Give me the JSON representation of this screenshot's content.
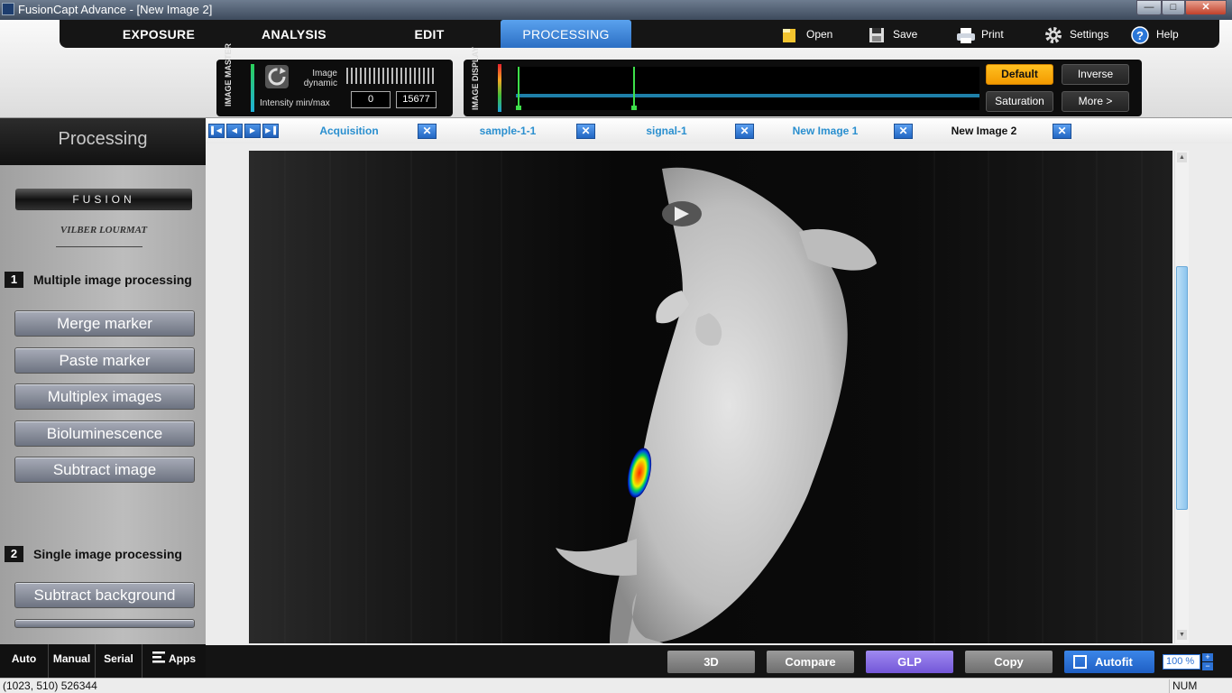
{
  "window": {
    "title": "FusionCapt Advance - [New Image 2]",
    "min_label": "—",
    "max_label": "□",
    "close_label": "✕"
  },
  "menu": {
    "tabs": [
      {
        "label": "EXPOSURE",
        "active": false
      },
      {
        "label": "ANALYSIS",
        "active": false
      },
      {
        "label": "EDIT",
        "active": false
      },
      {
        "label": "PROCESSING",
        "active": true
      }
    ],
    "tools": [
      {
        "label": "Open",
        "icon": "folder-icon"
      },
      {
        "label": "Save",
        "icon": "floppy-disk-icon"
      },
      {
        "label": "Print",
        "icon": "printer-icon"
      },
      {
        "label": "Settings",
        "icon": "gear-icon"
      },
      {
        "label": "Help",
        "icon": "help-icon"
      }
    ]
  },
  "image_master": {
    "label": "IMAGE MASTER",
    "dynamic_label": "Image dynamic",
    "intensity_label": "Intensity min/max",
    "min_value": "0",
    "max_value": "15677"
  },
  "image_display": {
    "label": "IMAGE DISPLAY",
    "buttons": [
      {
        "label": "Default",
        "active": true
      },
      {
        "label": "Inverse",
        "active": false
      },
      {
        "label": "Saturation",
        "active": false
      },
      {
        "label": "More >",
        "active": false
      }
    ]
  },
  "sidebar": {
    "title": "Processing",
    "brand": "FUSION",
    "maker": "VILBER LOURMAT",
    "section1": {
      "number": "1",
      "title": "Multiple image processing"
    },
    "buttons1": [
      "Merge marker",
      "Paste marker",
      "Multiplex images",
      "Bioluminescence",
      "Subtract image"
    ],
    "section2": {
      "number": "2",
      "title": "Single image processing"
    },
    "buttons2": [
      "Subtract background"
    ],
    "bottom": [
      "Auto",
      "Manual",
      "Serial",
      "Apps"
    ]
  },
  "image_tabs": [
    {
      "label": "Acquisition",
      "active": false
    },
    {
      "label": "sample-1-1",
      "active": false
    },
    {
      "label": "signal-1",
      "active": false
    },
    {
      "label": "New Image 1",
      "active": false
    },
    {
      "label": "New Image 2",
      "active": true
    }
  ],
  "bottom_toolbar": {
    "buttons": [
      "3D",
      "Compare",
      "GLP",
      "Copy",
      "Autofit"
    ],
    "colors": {
      "glp": "#8a6fe6",
      "autofit": "#2c72d6"
    },
    "zoom": "100 %"
  },
  "status": {
    "coords": "(1023, 510) 526344",
    "num": "NUM"
  }
}
